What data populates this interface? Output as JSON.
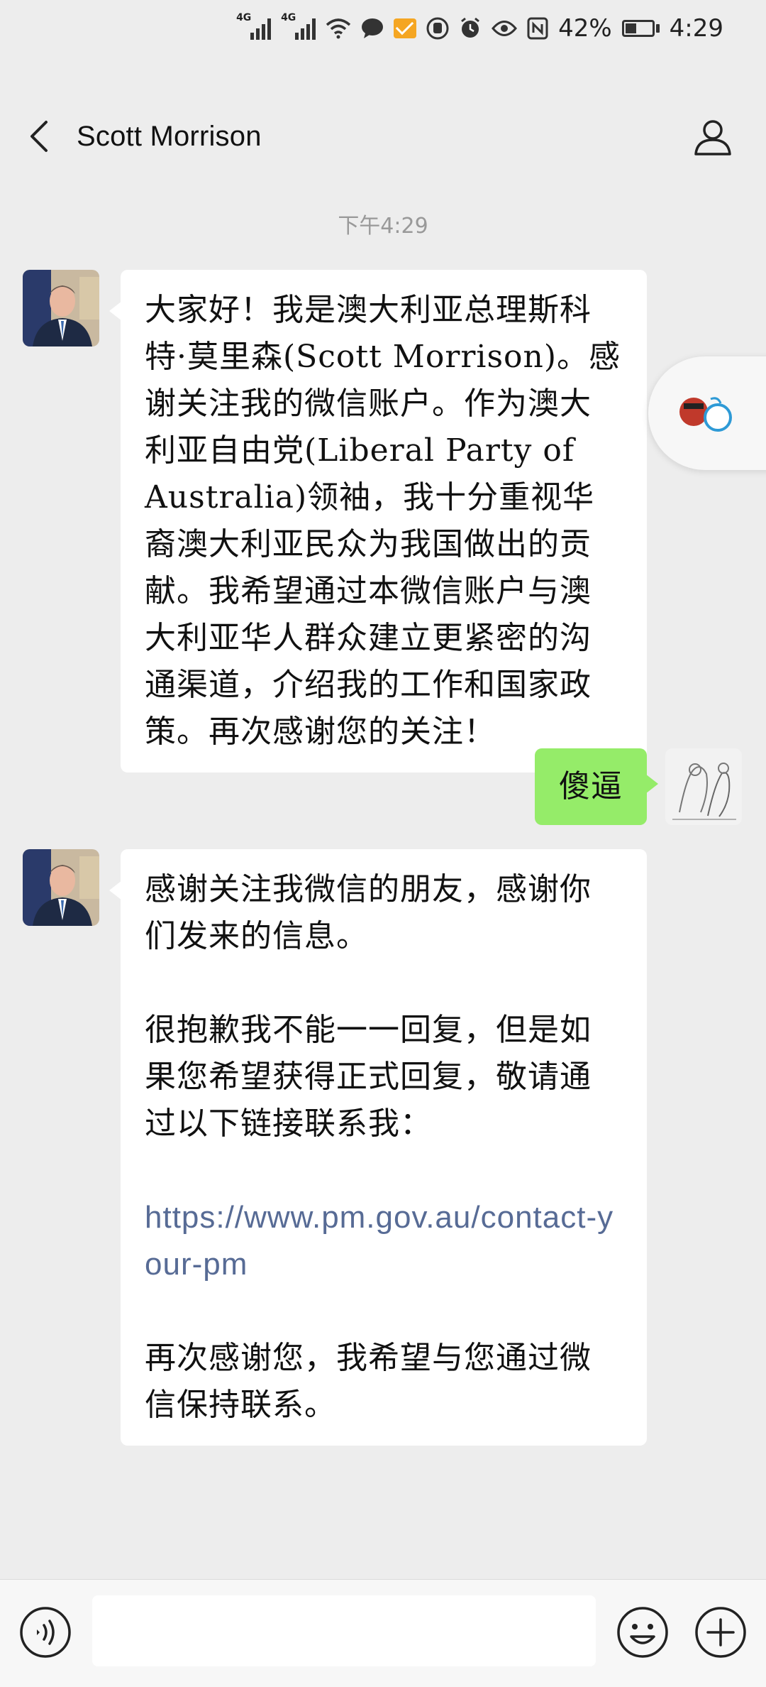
{
  "status_bar": {
    "net1": "4G",
    "net2": "4G",
    "battery": "42%",
    "time": "4:29",
    "icons": [
      "signal-icon",
      "signal-icon",
      "wifi-icon",
      "chat-icon",
      "mail-icon",
      "hand-icon",
      "alarm-icon",
      "eye-icon",
      "nfc-icon",
      "battery-icon"
    ]
  },
  "header": {
    "title": "Scott Morrison"
  },
  "chat": {
    "timestamp": "下午4:29",
    "messages": [
      {
        "sender": "Scott Morrison",
        "text": "大家好！我是澳大利亚总理斯科特·莫里森(Scott Morrison)。感谢关注我的微信账户。作为澳大利亚自由党(Liberal Party of Australia)领袖，我十分重视华裔澳大利亚民众为我国做出的贡献。我希望通过本微信账户与澳大利亚华人群众建立更紧密的沟通渠道，介绍我的工作和国家政策。再次感谢您的关注！"
      },
      {
        "sender": "me",
        "text": "傻逼"
      },
      {
        "sender": "Scott Morrison",
        "p1": "感谢关注我微信的朋友，感谢你们发来的信息。",
        "p2": "很抱歉我不能一一回复，但是如果您希望获得正式回复，敬请通过以下链接联系我：",
        "link": "https://www.pm.gov.au/contact-your-pm",
        "p3": "再次感谢您，我希望与您通过微信保持联系。"
      }
    ]
  },
  "input_bar": {
    "placeholder": ""
  },
  "colors": {
    "background": "#ededed",
    "sent_bubble": "#95ec69",
    "received_bubble": "#ffffff",
    "link": "#576b95"
  }
}
